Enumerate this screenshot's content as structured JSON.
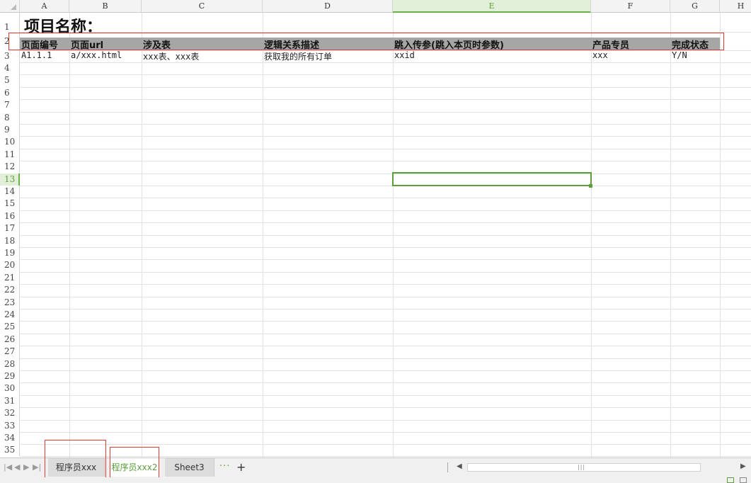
{
  "columns": [
    "A",
    "B",
    "C",
    "D",
    "E",
    "F",
    "G",
    "H"
  ],
  "active_column": "E",
  "rows": [
    "1",
    "2",
    "3",
    "4",
    "5",
    "6",
    "7",
    "8",
    "9",
    "10",
    "11",
    "12",
    "13",
    "14",
    "15",
    "16",
    "17",
    "18",
    "19",
    "20",
    "21",
    "22",
    "23",
    "24",
    "25",
    "26",
    "27",
    "28",
    "29",
    "30",
    "31",
    "32",
    "33",
    "34",
    "35"
  ],
  "active_row": "13",
  "sheet": {
    "title": "项目名称：",
    "headers": [
      "页面编号",
      "页面url",
      "涉及表",
      "逻辑关系描述",
      "跳入传参(跳入本页时参数)",
      "产品专员",
      "完成状态"
    ],
    "data_row": [
      "A1.1.1",
      "a/xxx.html",
      "xxx表、xxx表",
      "获取我的所有订单",
      "xxid",
      "xxx",
      "Y/N"
    ]
  },
  "tabs": [
    {
      "label": "程序员xxx",
      "active": false
    },
    {
      "label": "程序员xxx2",
      "active": true
    },
    {
      "label": "Sheet3",
      "active": false
    }
  ],
  "tab_more": "···",
  "tab_add": "+",
  "accent_color": "#5c9f3a",
  "annotation_color": "#e53935",
  "icons": [
    "first-sheet-icon",
    "prev-sheet-icon",
    "next-sheet-icon",
    "last-sheet-icon",
    "add-sheet-icon",
    "scroll-left-icon",
    "scroll-right-icon"
  ]
}
